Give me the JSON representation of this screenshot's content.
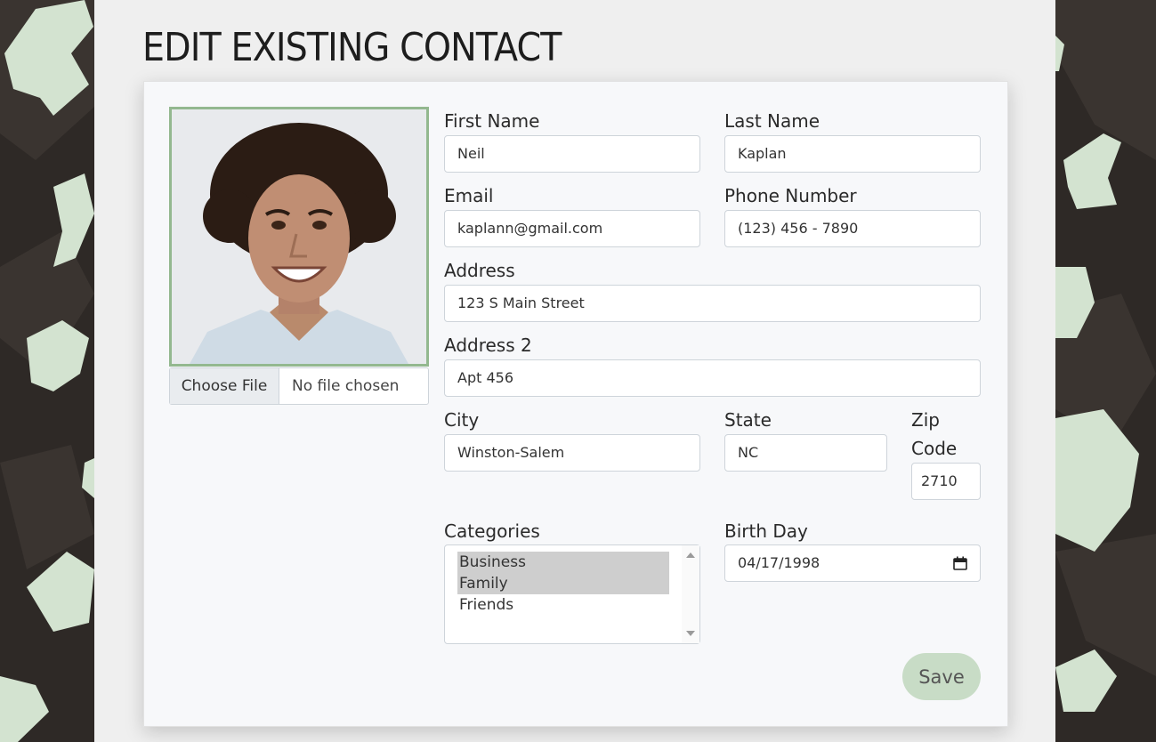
{
  "page": {
    "title": "EDIT EXISTING CONTACT"
  },
  "photo": {
    "alt": "contact photo"
  },
  "file_picker": {
    "button_label": "Choose File",
    "status": "No file chosen"
  },
  "fields": {
    "first_name": {
      "label": "First Name",
      "value": "Neil"
    },
    "last_name": {
      "label": "Last Name",
      "value": "Kaplan"
    },
    "email": {
      "label": "Email",
      "value": "kaplann@gmail.com"
    },
    "phone": {
      "label": "Phone Number",
      "value": "(123) 456 - 7890"
    },
    "address": {
      "label": "Address",
      "value": "123 S Main Street"
    },
    "address2": {
      "label": "Address 2",
      "value": "Apt 456"
    },
    "city": {
      "label": "City",
      "value": "Winston-Salem"
    },
    "state": {
      "label": "State",
      "value": "NC"
    },
    "zip": {
      "label_line1": "Zip",
      "label_line2": "Code",
      "value": "2710"
    },
    "categories": {
      "label": "Categories",
      "options": [
        {
          "label": "Business",
          "selected": true
        },
        {
          "label": "Family",
          "selected": true
        },
        {
          "label": "Friends",
          "selected": false
        }
      ]
    },
    "birthday": {
      "label": "Birth Day",
      "value": "04/17/1998"
    }
  },
  "save_label": "Save",
  "colors": {
    "accent": "#93b88f",
    "save_bg": "#c8dcc6",
    "background_dark": "#2e2926",
    "bones": "#d3e3d0"
  },
  "icons": [
    "calendar-icon",
    "scroll-up-icon",
    "scroll-down-icon"
  ]
}
